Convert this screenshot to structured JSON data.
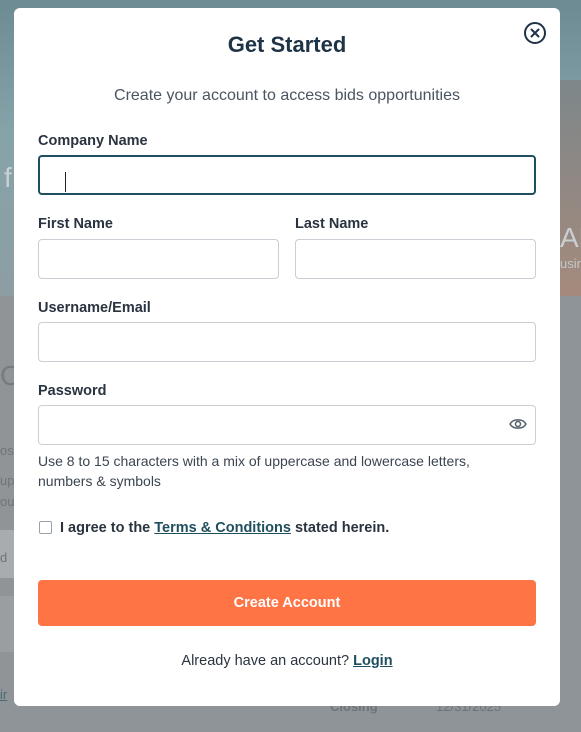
{
  "modal": {
    "title": "Get Started",
    "subtitle": "Create your account to access bids opportunities",
    "fields": {
      "company_name": {
        "label": "Company Name",
        "value": "",
        "placeholder": ""
      },
      "first_name": {
        "label": "First Name",
        "value": "",
        "placeholder": ""
      },
      "last_name": {
        "label": "Last Name",
        "value": "",
        "placeholder": ""
      },
      "username_email": {
        "label": "Username/Email",
        "value": "",
        "placeholder": ""
      },
      "password": {
        "label": "Password",
        "value": "",
        "placeholder": ""
      }
    },
    "password_hint": "Use 8 to 15 characters with a mix of uppercase and lowercase letters, numbers & symbols",
    "agree": {
      "prefix": "I agree to the ",
      "link": "Terms & Conditions",
      "suffix": " stated herein."
    },
    "create_button": "Create Account",
    "footer": {
      "text": "Already have an account? ",
      "link": "Login"
    },
    "icons": [
      "close-circle-icon",
      "eye-icon",
      "checkbox-icon"
    ]
  },
  "background": {
    "hero_fragment_left": "f",
    "hero_fragment_right": "AL",
    "hero_fragment_right_sub": "usin",
    "left_fragment_co": "Co",
    "left_fragment_1": "os",
    "left_fragment_2": "up",
    "left_fragment_3": "our",
    "left_fragment_4": "d",
    "left_fragment_5": "ir",
    "closing_label": "Closing",
    "closing_date": "12/31/2025"
  },
  "colors": {
    "accent": "#ff7444",
    "heading": "#1f3347",
    "link": "#1f4f5f",
    "focus_border": "#1f4f5f"
  }
}
